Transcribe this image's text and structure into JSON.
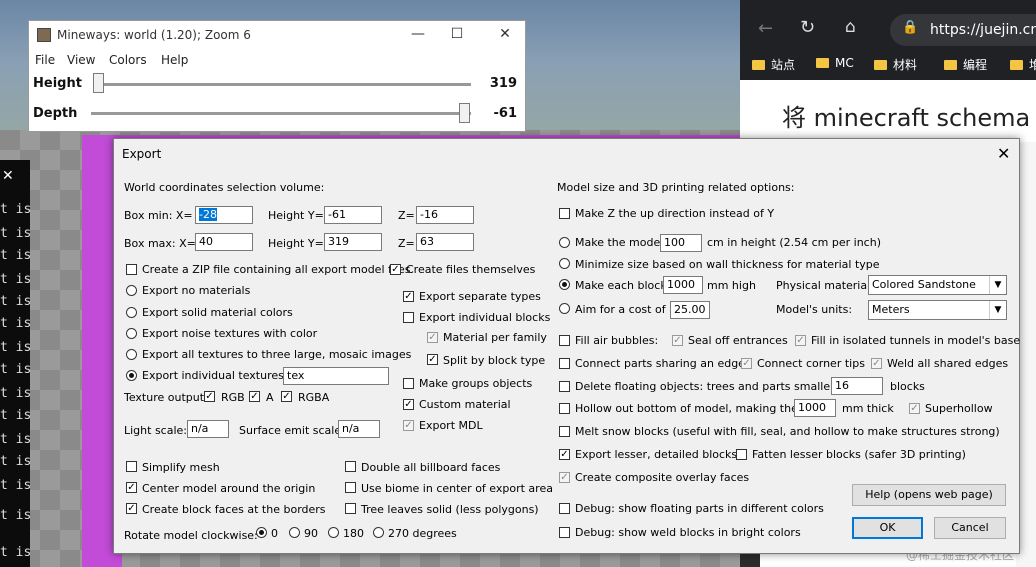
{
  "mineways": {
    "title": "Mineways: world (1.20); Zoom 6",
    "menu": [
      "File",
      "View",
      "Colors",
      "Help"
    ],
    "height_label": "Height",
    "height_value": "319",
    "depth_label": "Depth",
    "depth_value": "-61"
  },
  "browser": {
    "url": "https://juejin.cn/",
    "bookmarks": [
      "站点",
      "MC",
      "材料",
      "编程",
      "堆"
    ],
    "article_title": "将 minecraft schema 导",
    "watermark": "@稀土掘金技术社区"
  },
  "terminal": {
    "line_text": "t is"
  },
  "dialog": {
    "title": "Export",
    "left": {
      "section_title": "World coordinates selection volume:",
      "box_min_label": "Box min:  X=",
      "box_min_x": "-28",
      "box_min_y_label": "Height Y=",
      "box_min_y": "-61",
      "box_min_z_label": "Z=",
      "box_min_z": "-16",
      "box_max_label": "Box max:  X=",
      "box_max_x": "40",
      "box_max_y_label": "Height Y=",
      "box_max_y": "319",
      "box_max_z_label": "Z=",
      "box_max_z": "63",
      "create_zip": "Create a ZIP file containing all export model files",
      "create_files": "Create files themselves",
      "export_no_materials": "Export no materials",
      "export_solid_colors": "Export solid material colors",
      "export_noise": "Export noise textures with color",
      "export_mosaic": "Export all textures to three large, mosaic images",
      "export_individual_textures": "Export individual textures to",
      "texture_dir": "tex",
      "texture_output": "Texture output:",
      "rgb": "RGB",
      "a": "A",
      "rgba": "RGBA",
      "export_separate_types": "Export separate types",
      "export_individual_blocks": "Export individual blocks",
      "material_per_family": "Material per family",
      "split_by_block_type": "Split by block type",
      "make_groups_objects": "Make groups objects",
      "custom_material": "Custom material",
      "export_mdl": "Export MDL",
      "light_scale_label": "Light scale:",
      "light_scale": "n/a",
      "surface_emit_label": "Surface emit scale:",
      "surface_emit": "n/a",
      "simplify_mesh": "Simplify mesh",
      "center_model": "Center model around the origin",
      "create_block_faces": "Create block faces at the borders",
      "double_billboard": "Double all billboard faces",
      "use_biome": "Use biome in center of export area",
      "tree_leaves_solid": "Tree leaves solid (less polygons)",
      "rotate_label": "Rotate model clockwise:",
      "rotate_options": [
        "0",
        "90",
        "180",
        "270 degrees"
      ]
    },
    "right": {
      "section_title": "Model size and 3D printing related options:",
      "make_z_up": "Make Z the up direction instead of Y",
      "make_model_label": "Make the model",
      "make_model_value": "100",
      "make_model_suffix": "cm in height (2.54 cm per inch)",
      "minimize_size": "Minimize size based on wall thickness for material type",
      "make_each_block_label": "Make each block",
      "make_each_block_value": "1000",
      "make_each_block_suffix": "mm high",
      "physical_material_label": "Physical material:",
      "physical_material": "Colored Sandstone",
      "aim_for_cost_label": "Aim for a cost of",
      "aim_for_cost_value": "25.00",
      "models_units_label": "Model's units:",
      "models_units": "Meters",
      "fill_air_bubbles": "Fill air bubbles:",
      "seal_off_entrances": "Seal off entrances",
      "fill_isolated_tunnels": "Fill in isolated tunnels in model's base",
      "connect_parts_edge": "Connect parts sharing an edge:",
      "connect_corner_tips": "Connect corner tips",
      "weld_shared_edges": "Weld all shared edges",
      "delete_floating": "Delete floating objects: trees and parts smaller than",
      "delete_floating_value": "16",
      "delete_floating_suffix": "blocks",
      "hollow_out": "Hollow out bottom of model, making the walls",
      "hollow_value": "1000",
      "hollow_suffix": "mm thick",
      "superhollow": "Superhollow",
      "melt_snow": "Melt snow blocks (useful with fill, seal, and hollow to make structures strong)",
      "export_lesser": "Export lesser, detailed blocks:",
      "fatten_lesser": "Fatten lesser blocks (safer 3D printing)",
      "composite_overlay": "Create composite overlay faces",
      "debug_floating": "Debug: show floating parts in different colors",
      "debug_weld": "Debug: show weld blocks in bright colors",
      "help_button": "Help (opens web page)",
      "ok_button": "OK",
      "cancel_button": "Cancel"
    }
  }
}
